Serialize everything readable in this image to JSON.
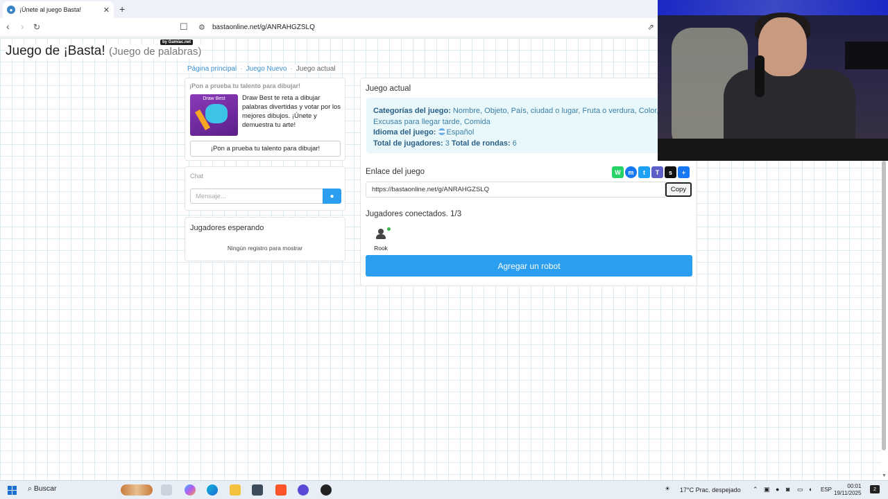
{
  "browser": {
    "tab_title": "¡Únete al juego Basta!",
    "tab_close": "✕",
    "new_tab": "+",
    "url": "bastaonline.net/g/ANRAHGZSLQ"
  },
  "site": {
    "title": "Juego de ¡Basta!",
    "subtitle": "(Juego de palabras)",
    "badge": "by Gamiac.net"
  },
  "breadcrumb": {
    "home": "Página principal",
    "new_game": "Juego Nuevo",
    "current": "Juego actual"
  },
  "ad": {
    "header": "¡Pon a prueba tu talento para dibujar!",
    "image_label": "Draw Best",
    "text": "Draw Best te reta a dibujar palabras divertidas y votar por los mejores dibujos. ¡Únete y demuestra tu arte!",
    "button": "¡Pon a prueba tu talento para dibujar!"
  },
  "chat": {
    "header": "Chat",
    "placeholder": "Mensaje..."
  },
  "waiting": {
    "title": "Jugadores esperando",
    "empty": "Ningún registro para mostrar"
  },
  "game": {
    "title": "Juego actual",
    "categories_label": "Categorías del juego:",
    "categories_value": "Nombre, Objeto, País, ciudad o lugar, Fruta o verdura, Color, A",
    "categories_value2": "Excusas para llegar tarde, Comida",
    "language_label": "Idioma del juego:",
    "language_value": "Español",
    "players_label": "Total de jugadores:",
    "players_value": "3",
    "rounds_label": "Total de rondas:",
    "rounds_value": "6",
    "link_label": "Enlace del juego",
    "link_value": "https://bastaonline.net/g/ANRAHGZSLQ",
    "copy": "Copy",
    "connected": "Jugadores conectados. 1/3",
    "player_name": "Rook",
    "robot_button": "Agregar un robot"
  },
  "share_icons": [
    {
      "name": "whatsapp",
      "color": "#25d366",
      "glyph": "W"
    },
    {
      "name": "messenger",
      "color": "#1877f2",
      "glyph": "m"
    },
    {
      "name": "twitter",
      "color": "#1da1f2",
      "glyph": "t"
    },
    {
      "name": "teams",
      "color": "#5b5fc7",
      "glyph": "T"
    },
    {
      "name": "snapchat",
      "color": "#111111",
      "glyph": "s"
    },
    {
      "name": "share-plus",
      "color": "#1877f2",
      "glyph": "+"
    }
  ],
  "taskbar": {
    "search": "Buscar",
    "weather": "17°C  Prac. despejado",
    "lang": "ESP",
    "time": "00:01",
    "date": "19/11/2025",
    "notifications": "2"
  }
}
